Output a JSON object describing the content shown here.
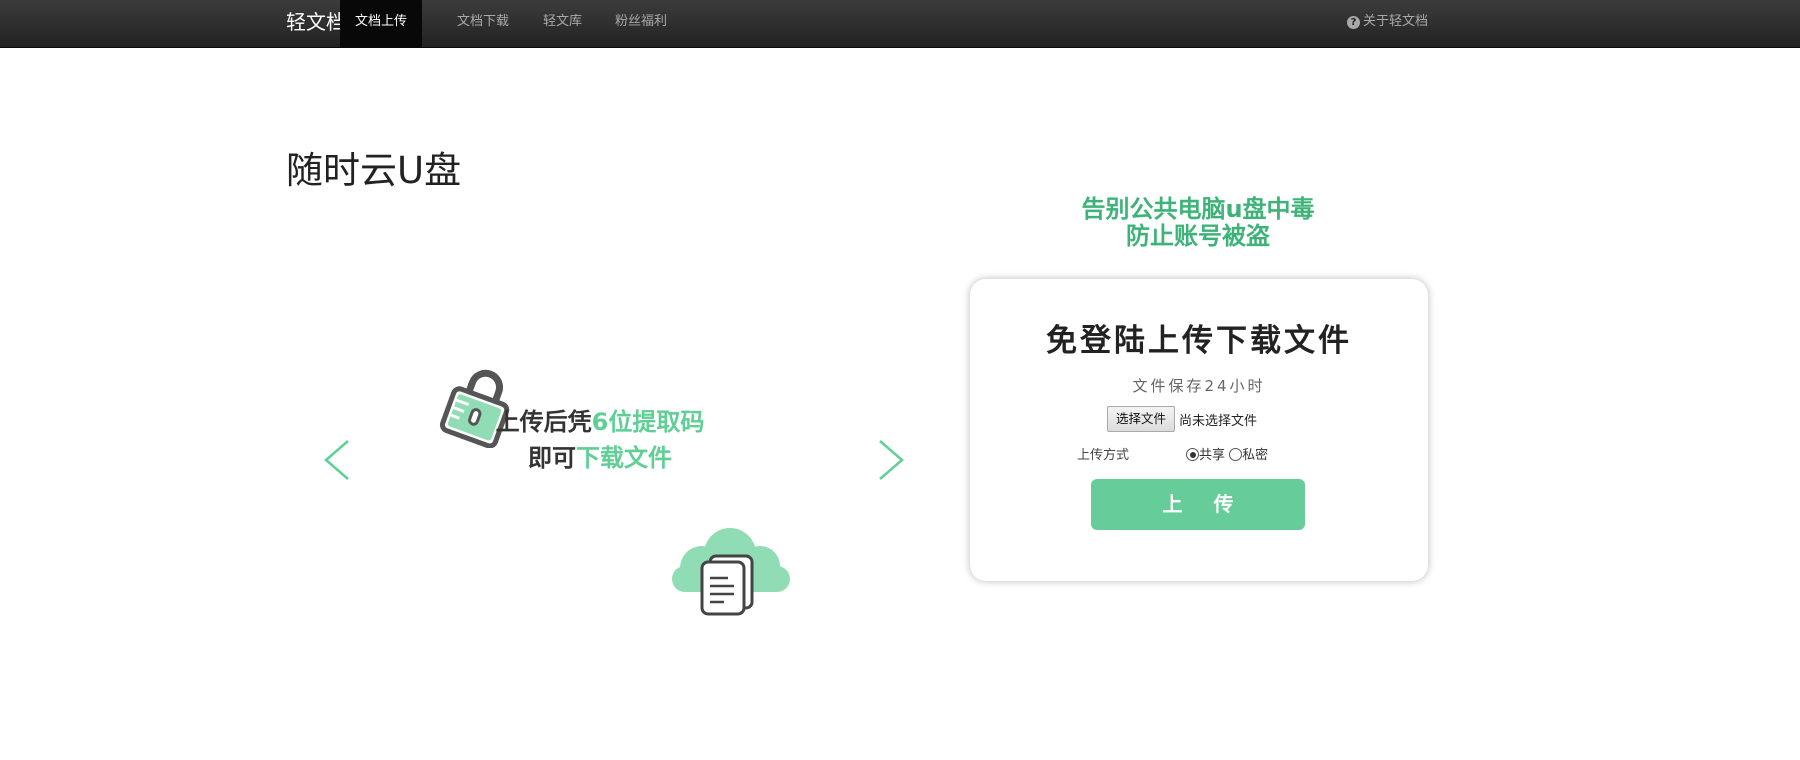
{
  "nav": {
    "brand": "轻文档",
    "items": [
      {
        "label": "文档上传",
        "active": true
      },
      {
        "label": "文档下载",
        "active": false
      },
      {
        "label": "轻文库",
        "active": false
      },
      {
        "label": "粉丝福利",
        "active": false
      }
    ],
    "about_label": "关于轻文档"
  },
  "page": {
    "title": "随时云U盘"
  },
  "carousel": {
    "line1_dark": "上传后凭",
    "line1_green": "6位提取码",
    "line2_dark": "即可",
    "line2_green": "下载文件"
  },
  "panel": {
    "slogan_line1": "告别公共电脑u盘中毒",
    "slogan_line2": "防止账号被盗",
    "card_title": "免登陆上传下载文件",
    "card_sub": "文件保存24小时",
    "file_button": "选择文件",
    "file_status": "尚未选择文件",
    "mode_label": "上传方式",
    "modes": [
      {
        "label": "共享",
        "checked": true
      },
      {
        "label": "私密",
        "checked": false
      }
    ],
    "upload_button": "上 传"
  },
  "colors": {
    "accent_green": "#66cc9a",
    "slogan_green": "#3eb379",
    "navbar_bg": "#222222"
  },
  "icons": [
    "question-circle-icon",
    "lock-icon",
    "cloud-documents-icon",
    "chevron-left-icon",
    "chevron-right-icon"
  ]
}
